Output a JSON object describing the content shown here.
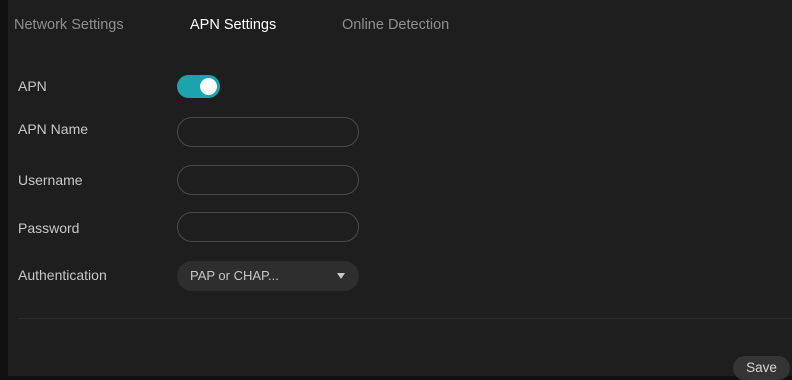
{
  "tabs": [
    {
      "label": "Network Settings",
      "active": false
    },
    {
      "label": "APN Settings",
      "active": true
    },
    {
      "label": "Online Detection",
      "active": false
    }
  ],
  "form": {
    "apn": {
      "label": "APN",
      "enabled": true
    },
    "apn_name": {
      "label": "APN Name",
      "value": ""
    },
    "username": {
      "label": "Username",
      "value": ""
    },
    "password": {
      "label": "Password",
      "value": ""
    },
    "authentication": {
      "label": "Authentication",
      "selected": "PAP or CHAP..."
    }
  },
  "actions": {
    "save_label": "Save"
  },
  "colors": {
    "background": "#1e1e1e",
    "accent": "#1ba3ae",
    "field_border": "#4a4a4a",
    "select_fill": "#2e2e2e",
    "text": "#c8c8c8",
    "tab_inactive": "#8f8f8f",
    "tab_active": "#ffffff"
  }
}
